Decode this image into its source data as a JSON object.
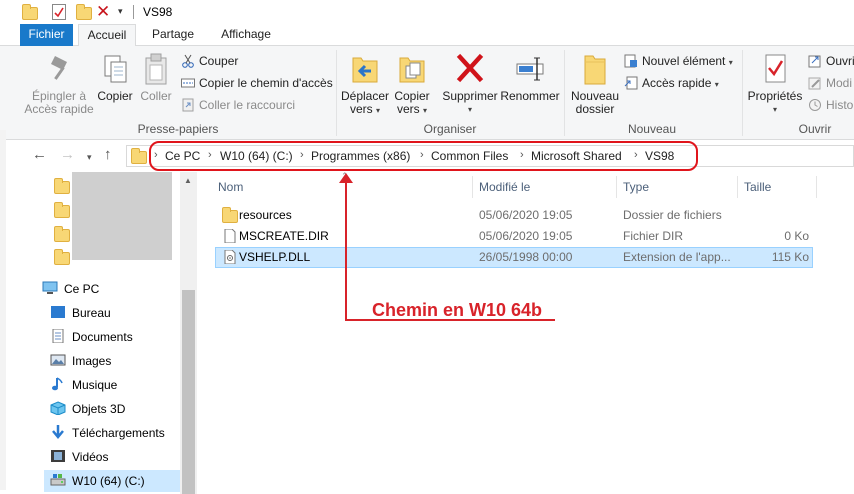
{
  "window": {
    "title": "VS98"
  },
  "ribbon_tabs": [
    {
      "label": "Fichier"
    },
    {
      "label": "Accueil"
    },
    {
      "label": "Partage"
    },
    {
      "label": "Affichage"
    }
  ],
  "ribbon": {
    "presse_papiers": {
      "label": "Presse-papiers",
      "pin_line1": "Épingler à",
      "pin_line2": "Accès rapide",
      "copy": "Copier",
      "paste": "Coller",
      "cut": "Couper",
      "copy_path": "Copier le chemin d'accès",
      "paste_shortcut": "Coller le raccourci"
    },
    "organiser": {
      "label": "Organiser",
      "move_line1": "Déplacer",
      "move_line2": "vers",
      "copyto_line1": "Copier",
      "copyto_line2": "vers",
      "delete": "Supprimer",
      "rename": "Renommer"
    },
    "nouveau": {
      "label": "Nouveau",
      "newfolder_line1": "Nouveau",
      "newfolder_line2": "dossier",
      "new_item": "Nouvel élément",
      "quick_access": "Accès rapide"
    },
    "ouvrir": {
      "label": "Ouvrir",
      "properties": "Propriétés",
      "open": "Ouvri",
      "modify": "Modi",
      "history": "Histo"
    }
  },
  "address": {
    "crumbs": [
      "Ce PC",
      "W10 (64) (C:)",
      "Programmes (x86)",
      "Common Files",
      "Microsoft Shared",
      "VS98"
    ]
  },
  "columns": {
    "name": "Nom",
    "modified": "Modifié le",
    "type": "Type",
    "size": "Taille"
  },
  "files": [
    {
      "name": "resources",
      "modified": "05/06/2020 19:05",
      "type": "Dossier de fichiers",
      "size": ""
    },
    {
      "name": "MSCREATE.DIR",
      "modified": "05/06/2020 19:05",
      "type": "Fichier DIR",
      "size": "0 Ko"
    },
    {
      "name": "VSHELP.DLL",
      "modified": "26/05/1998 00:00",
      "type": "Extension de l'app...",
      "size": "115 Ko"
    }
  ],
  "navpane": {
    "items": [
      {
        "label": "Ce PC"
      },
      {
        "label": "Bureau"
      },
      {
        "label": "Documents"
      },
      {
        "label": "Images"
      },
      {
        "label": "Musique"
      },
      {
        "label": "Objets 3D"
      },
      {
        "label": "Téléchargements"
      },
      {
        "label": "Vidéos"
      },
      {
        "label": "W10 (64) (C:)"
      }
    ]
  },
  "annotation": {
    "text": "Chemin en W10 64b"
  },
  "colors": {
    "accent": "#1979ca",
    "annotation": "#d8232a",
    "selection": "#cce8ff"
  }
}
